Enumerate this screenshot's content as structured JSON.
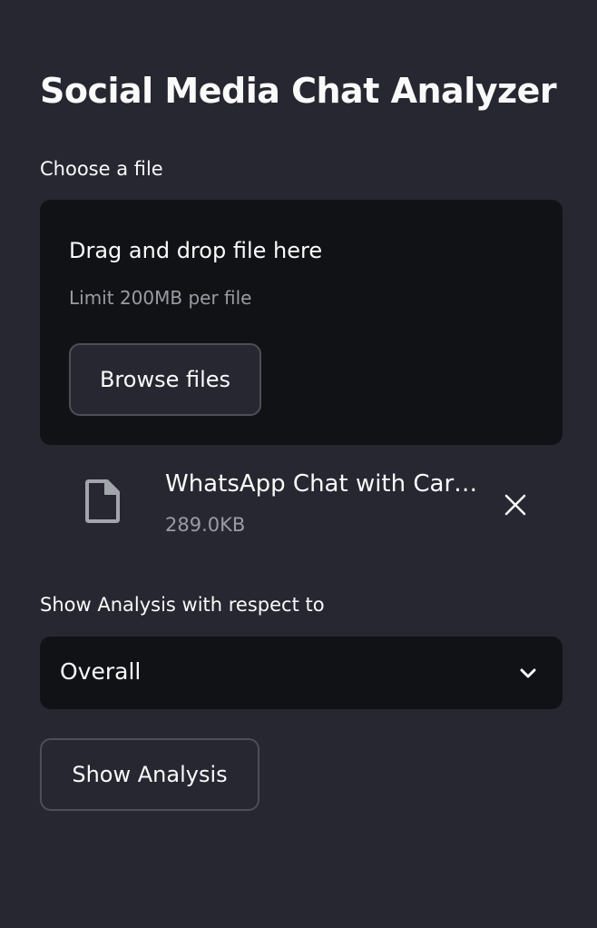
{
  "app": {
    "title": "Social Media Chat Analyzer"
  },
  "uploader": {
    "label": "Choose a file",
    "dropzone_title": "Drag and drop file here",
    "limit_text": "Limit 200MB per file",
    "browse_label": "Browse files"
  },
  "uploaded_file": {
    "icon": "file-icon",
    "name": "WhatsApp Chat with Car…",
    "size": "289.0KB",
    "remove_icon": "close-icon"
  },
  "analysis_select": {
    "label": "Show Analysis with respect to",
    "selected": "Overall",
    "chevron_icon": "chevron-down-icon"
  },
  "actions": {
    "show_analysis_label": "Show Analysis"
  },
  "colors": {
    "background": "#262730",
    "input_background": "#111216",
    "text": "#fafafa",
    "muted_text": "#9a9ca3",
    "button_border": "#4d4f58"
  }
}
